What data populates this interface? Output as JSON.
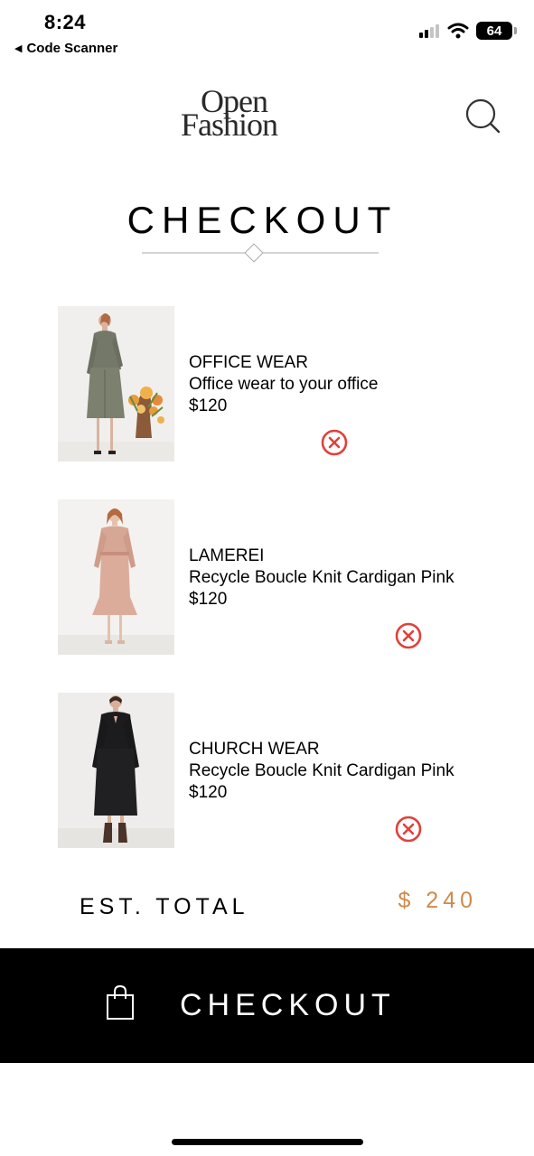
{
  "status_bar": {
    "time": "8:24",
    "back_app": "Code Scanner",
    "battery": "64",
    "icons": [
      "signal-icon",
      "wifi-icon",
      "battery-icon"
    ]
  },
  "header": {
    "logo_line1": "Open",
    "logo_line2": "Fashion",
    "search_icon": "search-icon"
  },
  "page_title": "CHECKOUT",
  "cart": {
    "items": [
      {
        "brand": "OFFICE WEAR",
        "name": "Office wear to your office",
        "price": "$120",
        "image": "woman in grey office dress with flowers"
      },
      {
        "brand": "LAMEREI",
        "name": "Recycle Boucle Knit Cardigan Pink",
        "price": "$120",
        "image": "woman in pink knit dress"
      },
      {
        "brand": "CHURCH WEAR",
        "name": "Recycle Boucle Knit Cardigan Pink",
        "price": "$120",
        "image": "woman in black dress"
      }
    ],
    "remove_icon": "remove-circle-icon"
  },
  "total": {
    "label": "EST. TOTAL",
    "value": "$ 240"
  },
  "checkout_button": {
    "label": "CHECKOUT",
    "icon": "shopping-bag-icon"
  },
  "colors": {
    "accent": "#cf8a4a",
    "remove": "#e0413a",
    "bar": "#000000"
  }
}
